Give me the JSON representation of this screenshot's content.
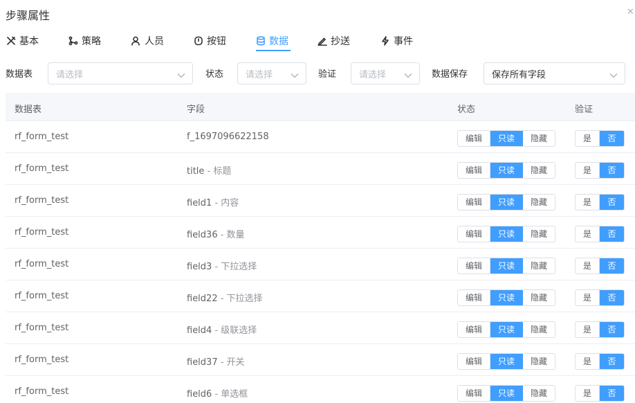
{
  "title": "步骤属性",
  "tabs": [
    {
      "label": "基本",
      "icon": "tools-icon"
    },
    {
      "label": "策略",
      "icon": "branch-icon"
    },
    {
      "label": "人员",
      "icon": "user-icon"
    },
    {
      "label": "按钮",
      "icon": "power-button-icon"
    },
    {
      "label": "数据",
      "icon": "database-icon",
      "active": true
    },
    {
      "label": "抄送",
      "icon": "pencil-icon"
    },
    {
      "label": "事件",
      "icon": "lightning-icon"
    }
  ],
  "filters": {
    "table_label": "数据表",
    "table_placeholder": "请选择",
    "state_label": "状态",
    "state_placeholder": "请选择",
    "verify_label": "验证",
    "verify_placeholder": "请选择",
    "save_label": "数据保存",
    "save_value": "保存所有字段"
  },
  "columns": [
    "数据表",
    "字段",
    "状态",
    "验证"
  ],
  "state_options": [
    "编辑",
    "只读",
    "隐藏"
  ],
  "verify_options": [
    "是",
    "否"
  ],
  "rows": [
    {
      "table": "rf_form_test",
      "field": "f_1697096622158",
      "label": ""
    },
    {
      "table": "rf_form_test",
      "field": "title",
      "label": " - 标题"
    },
    {
      "table": "rf_form_test",
      "field": "field1",
      "label": " - 内容"
    },
    {
      "table": "rf_form_test",
      "field": "field36",
      "label": " - 数量"
    },
    {
      "table": "rf_form_test",
      "field": "field3",
      "label": " - 下拉选择"
    },
    {
      "table": "rf_form_test",
      "field": "field22",
      "label": " - 下拉选择"
    },
    {
      "table": "rf_form_test",
      "field": "field4",
      "label": " - 级联选择"
    },
    {
      "table": "rf_form_test",
      "field": "field37",
      "label": " - 开关"
    },
    {
      "table": "rf_form_test",
      "field": "field6",
      "label": " - 单选框"
    }
  ],
  "colors": {
    "accent": "#409eff",
    "header_bg": "#f5f7fa",
    "border": "#dcdfe6"
  }
}
